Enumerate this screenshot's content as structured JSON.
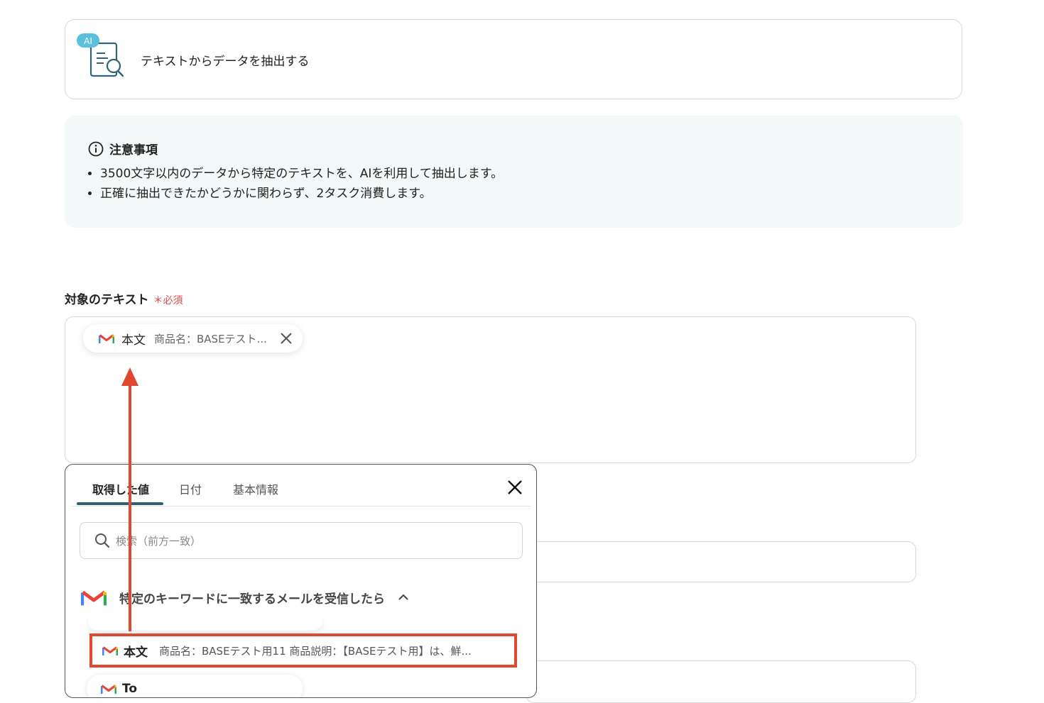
{
  "action": {
    "title": "テキストからデータを抽出する",
    "badge": "AI"
  },
  "notice": {
    "heading": "注意事項",
    "items": [
      "3500文字以内のデータから特定のテキストを、AIを利用して抽出します。",
      "正確に抽出できたかどうかに関わらず、2タスク消費します。"
    ]
  },
  "field": {
    "label": "対象のテキスト",
    "required_mark": "＊",
    "required_text": "必須",
    "chip": {
      "name": "本文",
      "value": "商品名：BASEテスト..."
    }
  },
  "popup": {
    "tabs": [
      {
        "label": "取得した値",
        "active": true
      },
      {
        "label": "日付",
        "active": false
      },
      {
        "label": "基本情報",
        "active": false
      }
    ],
    "search_placeholder": "検索（前方一致）",
    "group_title": "特定のキーワードに一致するメールを受信したら",
    "selected_item": {
      "name": "本文",
      "value": "商品名：BASEテスト用11 商品説明：【BASEテスト用】は、鮮..."
    },
    "next_item": {
      "name": "To"
    }
  },
  "colors": {
    "accent_underline": "#2f5f70",
    "required": "#e0474c",
    "annotation": "#e0482f",
    "notice_bg": "#f3f8f8"
  }
}
